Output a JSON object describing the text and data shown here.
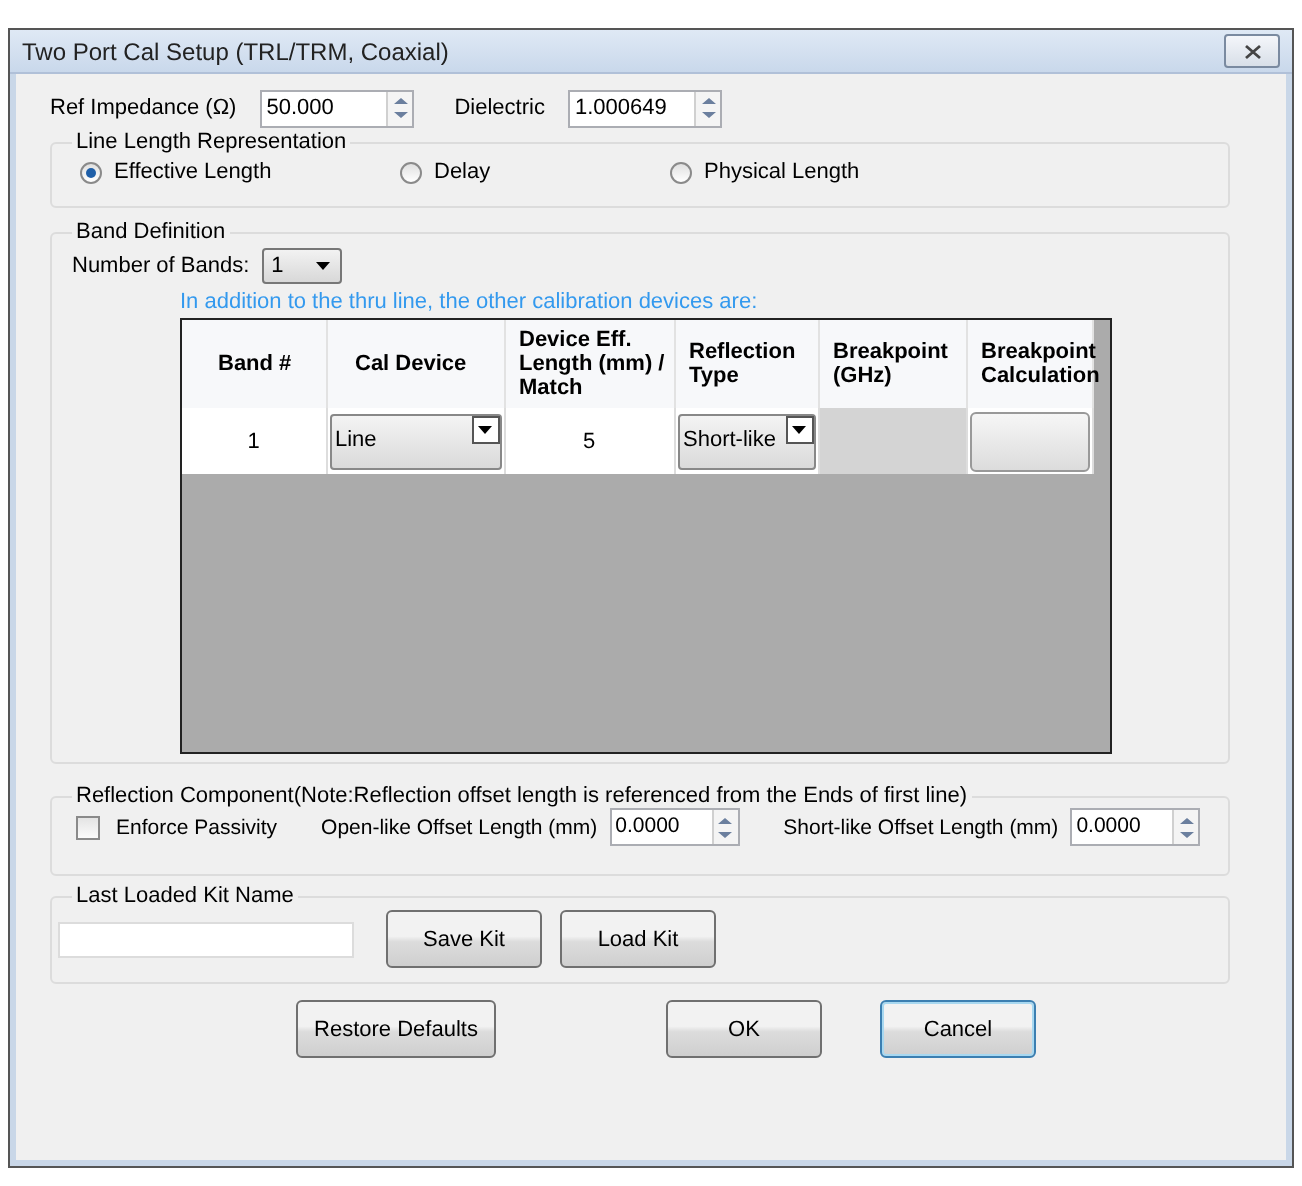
{
  "window": {
    "title": "Two Port Cal Setup (TRL/TRM, Coaxial)"
  },
  "ref_impedance": {
    "label": "Ref Impedance (Ω)",
    "value": "50.000"
  },
  "dielectric": {
    "label": "Dielectric",
    "value": "1.000649"
  },
  "line_length_representation": {
    "title": "Line Length Representation",
    "options": [
      {
        "label": "Effective Length",
        "selected": true
      },
      {
        "label": "Delay",
        "selected": false
      },
      {
        "label": "Physical Length",
        "selected": false
      }
    ]
  },
  "band_definition": {
    "title": "Band Definition",
    "number_of_bands": {
      "label": "Number of Bands:",
      "value": "1"
    },
    "note": "In addition to the thru line, the other calibration devices are:",
    "table": {
      "columns": [
        "Band #",
        "Cal Device",
        "Device Eff. Length (mm) / Match",
        "Reflection Type",
        "Breakpoint (GHz)",
        "Breakpoint Calculation"
      ],
      "rows": [
        {
          "cells": [
            {
              "kind": "text",
              "value": "1"
            },
            {
              "kind": "dropdown",
              "value": "Line"
            },
            {
              "kind": "text",
              "value": "5"
            },
            {
              "kind": "dropdown",
              "value": "Short-like"
            },
            {
              "kind": "disabled"
            },
            {
              "kind": "button"
            }
          ]
        }
      ]
    }
  },
  "reflection_component": {
    "title": "Reflection Component(Note:Reflection offset length is referenced from the Ends of first line)",
    "enforce_passivity": {
      "label": "Enforce Passivity",
      "checked": false
    },
    "open_offset": {
      "label": "Open-like Offset Length (mm)",
      "value": "0.0000"
    },
    "short_offset": {
      "label": "Short-like Offset Length (mm)",
      "value": "0.0000"
    }
  },
  "kit": {
    "title": "Last Loaded Kit Name",
    "buttons": [
      "Save Kit",
      "Load Kit"
    ]
  },
  "buttons": [
    {
      "label": "Restore Defaults",
      "focused": false
    },
    {
      "label": "OK",
      "focused": false
    },
    {
      "label": "Cancel",
      "focused": true
    }
  ]
}
